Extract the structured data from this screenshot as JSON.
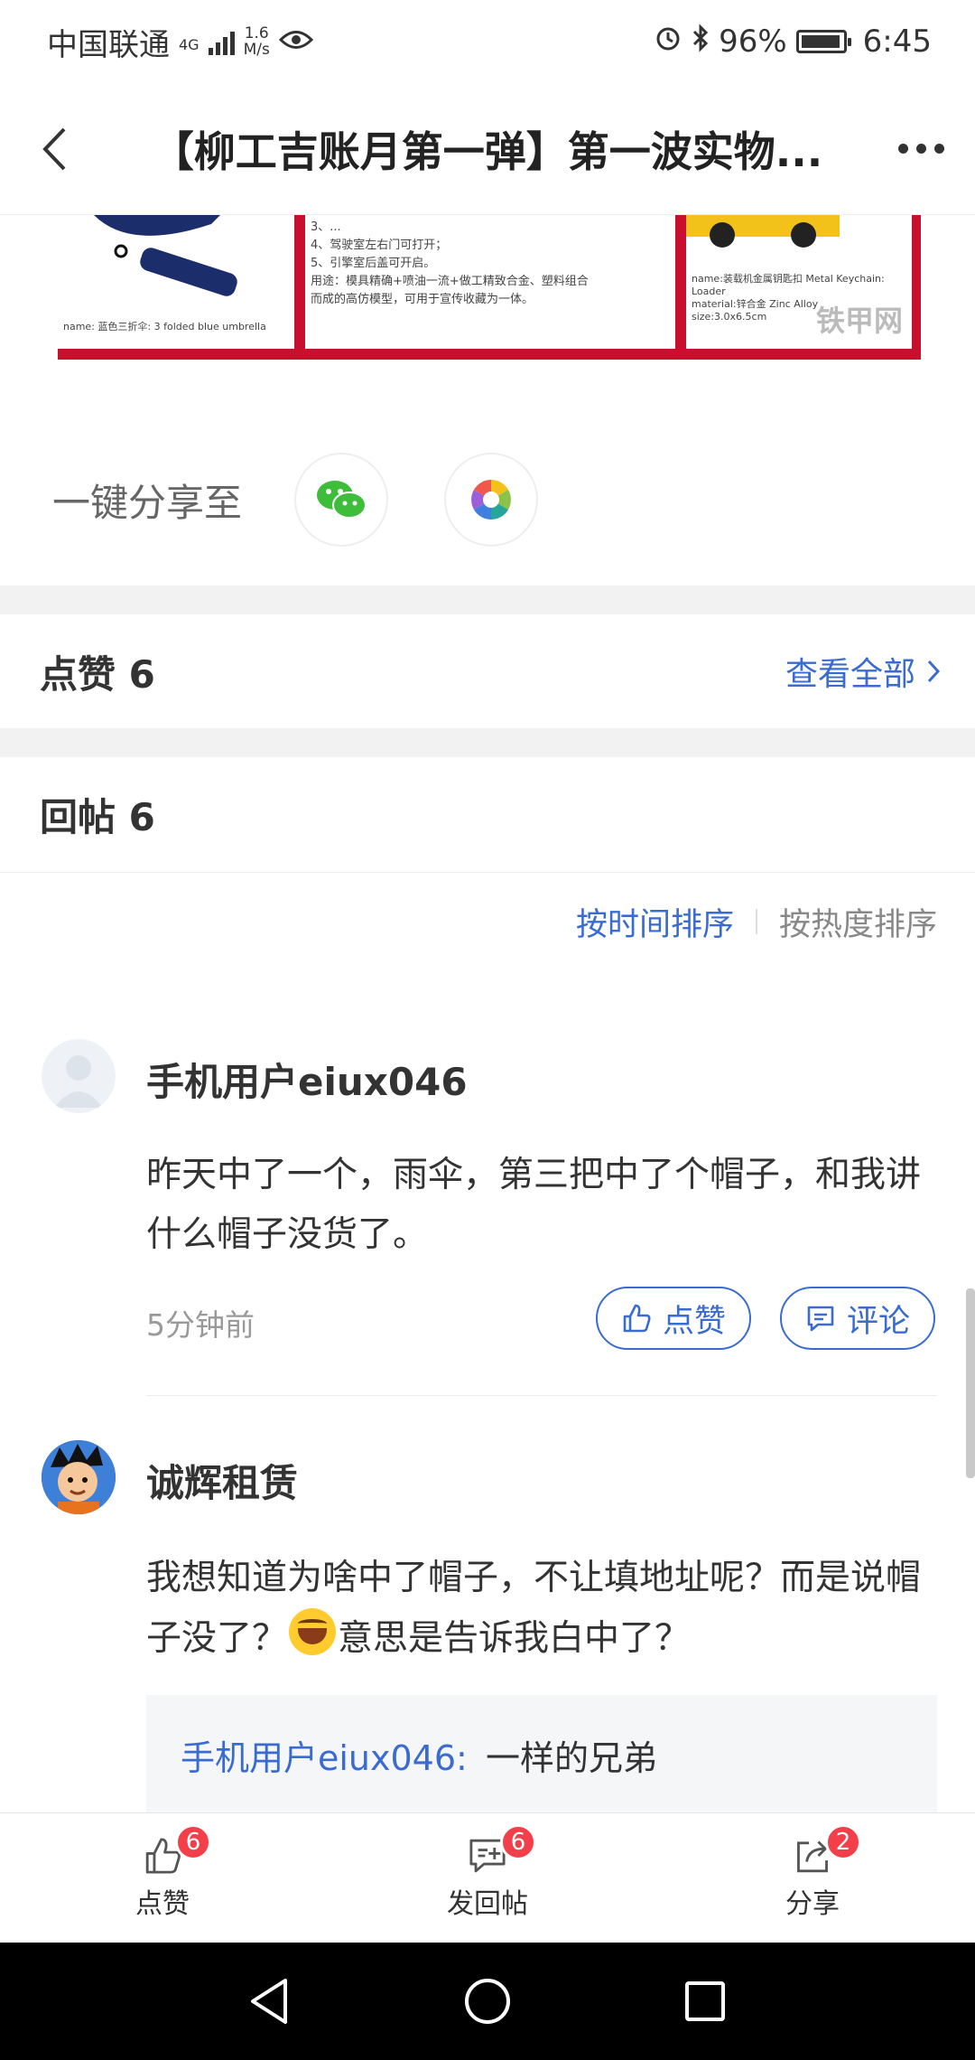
{
  "status_bar": {
    "carrier": "中国联通",
    "network": "4G",
    "speed": "1.6",
    "speed_unit": "M/s",
    "battery": "96%",
    "time": "6:45"
  },
  "header": {
    "title": "【柳工吉账月第一弹】第一波实物..."
  },
  "post_image": {
    "left_caption": "3、...\n4、驾驶室左右门可打开；\n5、引擎室后盖可开启。\n用途：模具精确+喷油一流+做工精致合金、塑料组合\n而成的高仿模型，可用于宣传收藏为一体。",
    "left_small": "name: 蓝色三折伞: 3 folded blue umbrella",
    "right_caption": "name:装载机金属钥匙扣 Metal Keychain: Loader\nmaterial:锌合金 Zinc Alloy\nsize:3.0x6.5cm",
    "watermark": "铁甲网"
  },
  "share": {
    "label": "一键分享至"
  },
  "likes": {
    "title": "点赞 6",
    "view_all": "查看全部"
  },
  "replies": {
    "title": "回帖 6",
    "sort_time": "按时间排序",
    "sort_hot": "按热度排序"
  },
  "comments": [
    {
      "user": "手机用户eiux046",
      "text": "昨天中了一个，雨伞，第三把中了个帽子，和我讲什么帽子没货了。",
      "time": "5分钟前",
      "like_label": "点赞",
      "comment_label": "评论"
    },
    {
      "user": "诚辉租赁",
      "text_before_emoji": "我想知道为啥中了帽子，不让填地址呢？而是说帽子没了？",
      "text_after_emoji": "意思是告诉我白中了？",
      "reply_user": "手机用户eiux046:",
      "reply_text": "一样的兄弟"
    }
  ],
  "bottom_bar": {
    "like_label": "点赞",
    "like_count": "6",
    "reply_label": "发回帖",
    "reply_count": "6",
    "share_label": "分享",
    "share_count": "2"
  },
  "colors": {
    "accent": "#3a6bd0",
    "badge": "#f23f4a"
  }
}
